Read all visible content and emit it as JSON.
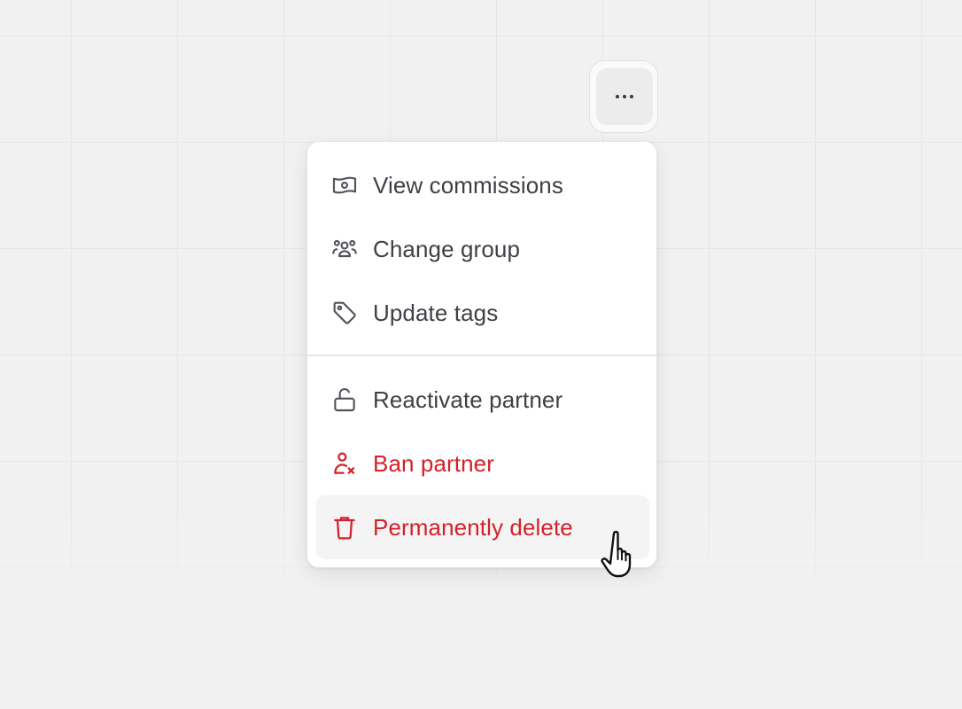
{
  "more_button": {
    "icon": "more-horizontal-icon"
  },
  "menu": {
    "groups": [
      [
        {
          "label": "View commissions",
          "icon": "banknote-icon",
          "tone": "default"
        },
        {
          "label": "Change group",
          "icon": "users-group-icon",
          "tone": "default"
        },
        {
          "label": "Update tags",
          "icon": "tag-icon",
          "tone": "default"
        }
      ],
      [
        {
          "label": "Reactivate partner",
          "icon": "unlock-icon",
          "tone": "default"
        },
        {
          "label": "Ban partner",
          "icon": "user-x-icon",
          "tone": "danger"
        },
        {
          "label": "Permanently delete",
          "icon": "trash-icon",
          "tone": "danger",
          "hovered": true
        }
      ]
    ]
  },
  "colors": {
    "background": "#f1f1f1",
    "text": "#3f3f46",
    "danger": "#d4202a",
    "hover_bg": "#f4f4f5"
  }
}
